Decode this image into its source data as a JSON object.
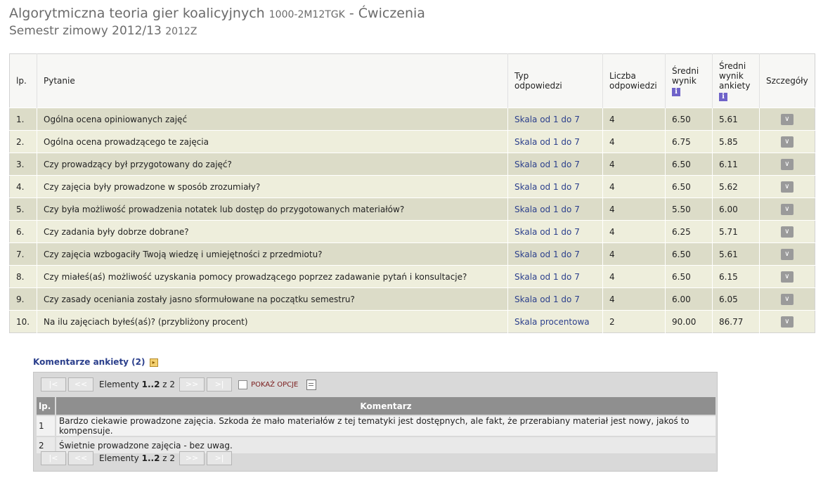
{
  "header": {
    "course_name": "Algorytmiczna teoria gier koalicyjnych",
    "course_code": "1000-2M12TGK",
    "separator": "-",
    "class_type": "Ćwiczenia",
    "semester": "Semestr zimowy 2012/13",
    "semester_code": "2012Z"
  },
  "survey_table": {
    "columns": {
      "lp": "lp.",
      "question": "Pytanie",
      "response_type": "Typ odpowiedzi",
      "response_count": "Liczba odpowiedzi",
      "avg_score": "Średni wynik",
      "avg_survey_score": "Średni wynik ankiety",
      "details": "Szczegóły"
    },
    "rows": [
      {
        "lp": "1.",
        "question": "Ogólna ocena opiniowanych zajęć",
        "type": "Skala od 1 do 7",
        "count": "4",
        "avg": "6.50",
        "avg_survey": "5.61"
      },
      {
        "lp": "2.",
        "question": "Ogólna ocena prowadzącego te zajęcia",
        "type": "Skala od 1 do 7",
        "count": "4",
        "avg": "6.75",
        "avg_survey": "5.85"
      },
      {
        "lp": "3.",
        "question": "Czy prowadzący był przygotowany do zajęć?",
        "type": "Skala od 1 do 7",
        "count": "4",
        "avg": "6.50",
        "avg_survey": "6.11"
      },
      {
        "lp": "4.",
        "question": "Czy zajęcia były prowadzone w sposób zrozumiały?",
        "type": "Skala od 1 do 7",
        "count": "4",
        "avg": "6.50",
        "avg_survey": "5.62"
      },
      {
        "lp": "5.",
        "question": "Czy była możliwość prowadzenia notatek lub dostęp do przygotowanych materiałów?",
        "type": "Skala od 1 do 7",
        "count": "4",
        "avg": "5.50",
        "avg_survey": "6.00"
      },
      {
        "lp": "6.",
        "question": "Czy zadania były dobrze dobrane?",
        "type": "Skala od 1 do 7",
        "count": "4",
        "avg": "6.25",
        "avg_survey": "5.71"
      },
      {
        "lp": "7.",
        "question": "Czy zajęcia wzbogaciły Twoją wiedzę i umiejętności z przedmiotu?",
        "type": "Skala od 1 do 7",
        "count": "4",
        "avg": "6.50",
        "avg_survey": "5.61"
      },
      {
        "lp": "8.",
        "question": "Czy miałeś(aś) możliwość uzyskania pomocy prowadzącego poprzez zadawanie pytań i konsultacje?",
        "type": "Skala od 1 do 7",
        "count": "4",
        "avg": "6.50",
        "avg_survey": "6.15"
      },
      {
        "lp": "9.",
        "question": "Czy zasady oceniania zostały jasno sformułowane na początku semestru?",
        "type": "Skala od 1 do 7",
        "count": "4",
        "avg": "6.00",
        "avg_survey": "6.05"
      },
      {
        "lp": "10.",
        "question": "Na ilu zajęciach byłeś(aś)? (przybliżony procent)",
        "type": "Skala procentowa",
        "count": "2",
        "avg": "90.00",
        "avg_survey": "86.77"
      }
    ]
  },
  "comments": {
    "heading": "Komentarze ankiety (2)",
    "pagination": {
      "first": "|<",
      "prev": "<<",
      "next": ">>",
      "last": ">|",
      "prefix": "Elementy",
      "range": "1..2",
      "of": "z",
      "total": "2",
      "options_label": "POKAŻ OPCJE"
    },
    "columns": {
      "lp": "lp.",
      "comment": "Komentarz"
    },
    "rows": [
      {
        "lp": "1",
        "text": "Bardzo ciekawie prowadzone zajęcia. Szkoda że mało materiałów z tej tematyki jest dostępnych, ale fakt, że przerabiany materiał jest nowy, jakoś to kompensuje."
      },
      {
        "lp": "2",
        "text": "Świetnie prowadzone zajęcia - bez uwag."
      }
    ]
  }
}
